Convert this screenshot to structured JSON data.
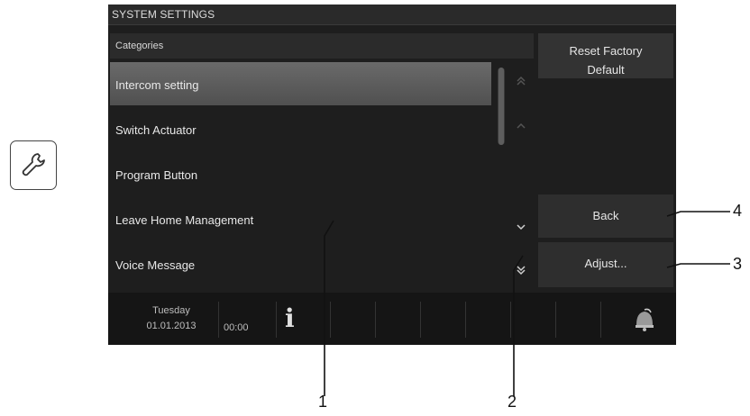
{
  "screen": {
    "title": "SYSTEM SETTINGS",
    "categories_header": "Categories",
    "items": [
      {
        "label": "Intercom setting",
        "selected": true
      },
      {
        "label": "Switch Actuator",
        "selected": false
      },
      {
        "label": "Program Button",
        "selected": false
      },
      {
        "label": "Leave Home Management",
        "selected": false
      },
      {
        "label": "Voice Message",
        "selected": false
      }
    ],
    "buttons": {
      "reset_line1": "Reset Factory",
      "reset_line2": "Default",
      "back": "Back",
      "adjust": "Adjust..."
    },
    "scroll_icons": [
      "double-up-icon",
      "up-icon",
      "down-icon",
      "double-down-icon"
    ],
    "status": {
      "day": "Tuesday",
      "date": "01.01.2013",
      "time": "00:00"
    }
  },
  "callouts": {
    "c1": "1",
    "c2": "2",
    "c3": "3",
    "c4": "4"
  },
  "icons": {
    "wrench": "wrench-icon",
    "info": "info-icon",
    "bell": "bell-icon"
  },
  "colors": {
    "screen_bg": "#1e1e1e",
    "selected_item": "#5a5a5a",
    "button_bg": "#2e2e2e"
  }
}
